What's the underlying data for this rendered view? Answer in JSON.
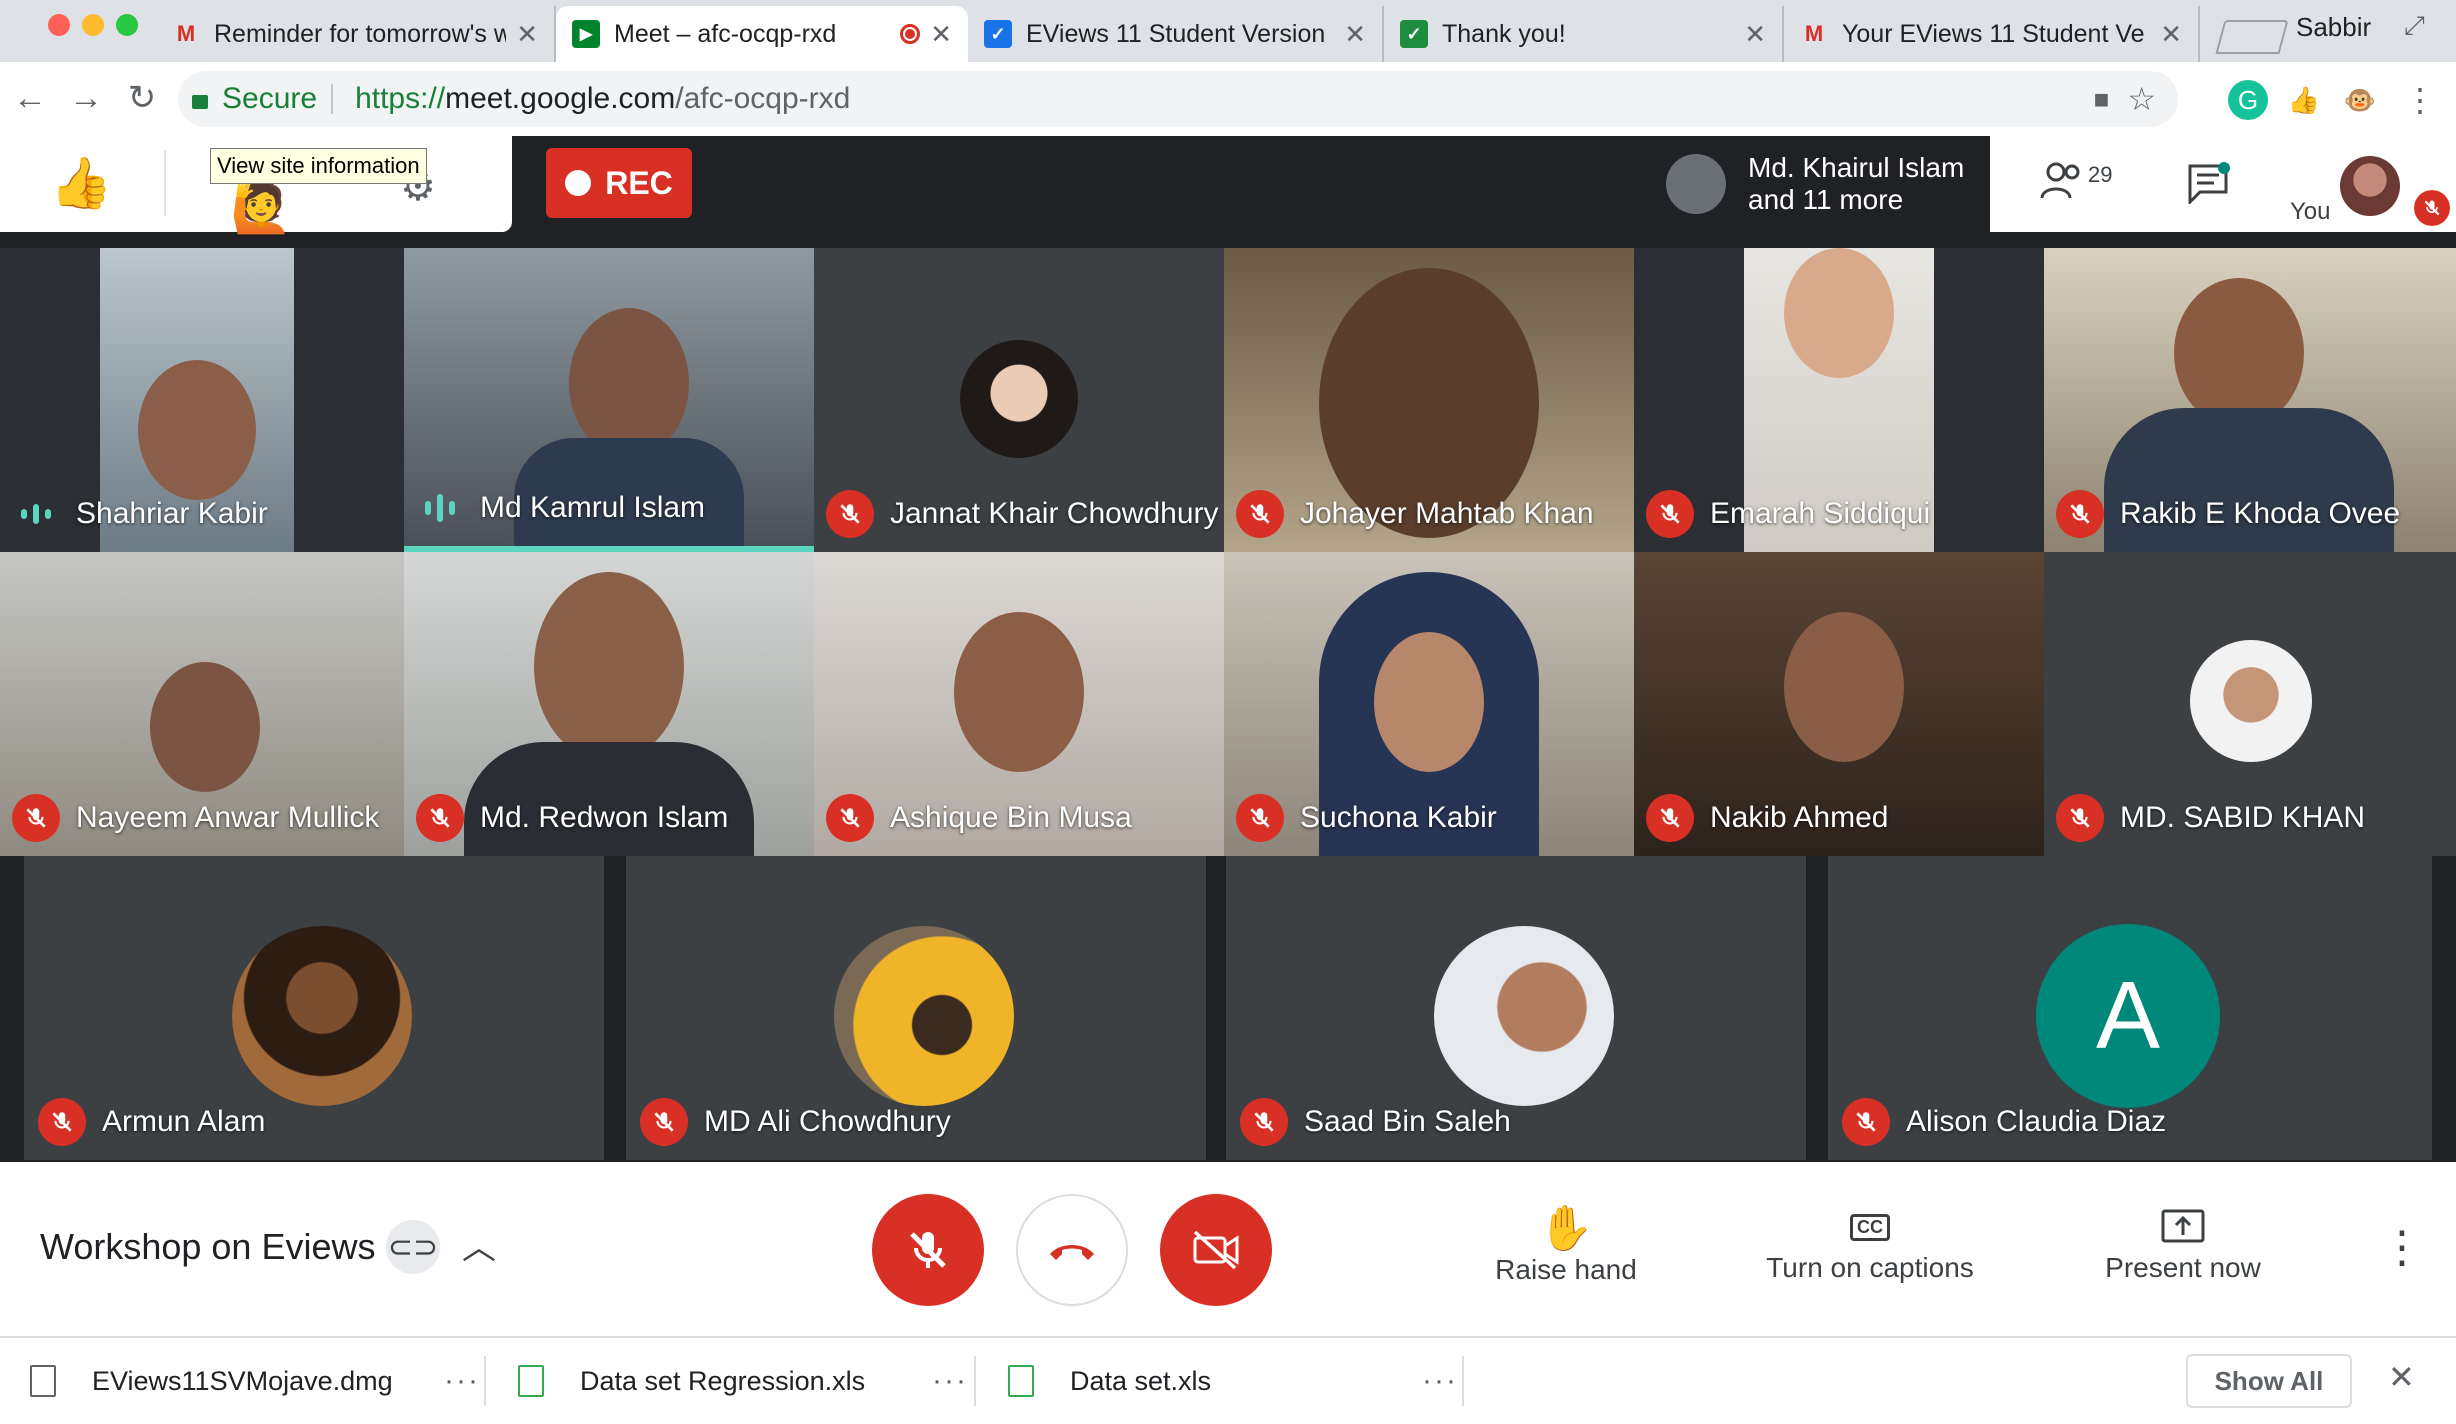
{
  "browser": {
    "profile_name": "Sabbir",
    "tabs": [
      {
        "title": "Reminder for tomorrow's w",
        "icon": "gmail-icon"
      },
      {
        "title": "Meet – afc-ocqp-rxd",
        "icon": "meet-icon",
        "active": true
      },
      {
        "title": "EViews 11 Student Version",
        "icon": "eviews-icon"
      },
      {
        "title": "Thank you!",
        "icon": "eviews-icon"
      },
      {
        "title": "Your EViews 11 Student Ve",
        "icon": "gmail-icon"
      }
    ],
    "secure_label": "Secure",
    "url_scheme": "https://",
    "url_host": "meet.google.com",
    "url_path": "/afc-ocqp-rxd",
    "tooltip": "View site information"
  },
  "meet": {
    "rec_label": "REC",
    "active_speaker_line1": "Md. Khairul Islam",
    "active_speaker_line2": "and 11 more",
    "participant_count": "29",
    "self_label": "You",
    "meeting_title": "Workshop on Eviews",
    "controls": {
      "raise_hand": "Raise hand",
      "captions": "Turn on captions",
      "present": "Present now"
    },
    "participants": [
      {
        "name": "Shahriar Kabir",
        "status": "speaking"
      },
      {
        "name": "Md Kamrul Islam",
        "status": "speaking"
      },
      {
        "name": "Jannat Khair Chowdhury",
        "status": "muted"
      },
      {
        "name": "Johayer Mahtab Khan",
        "status": "muted"
      },
      {
        "name": "Emarah Siddiqui",
        "status": "muted"
      },
      {
        "name": "Rakib E Khoda Ovee",
        "status": "muted"
      },
      {
        "name": "Nayeem Anwar Mullick",
        "status": "muted"
      },
      {
        "name": "Md. Redwon Islam",
        "status": "muted"
      },
      {
        "name": "Ashique Bin Musa",
        "status": "muted"
      },
      {
        "name": "Suchona Kabir",
        "status": "muted"
      },
      {
        "name": "Nakib Ahmed",
        "status": "muted"
      },
      {
        "name": "MD. SABID KHAN",
        "status": "muted"
      },
      {
        "name": "Armun Alam",
        "status": "muted"
      },
      {
        "name": "MD Ali Chowdhury",
        "status": "muted"
      },
      {
        "name": "Saad Bin Saleh",
        "status": "muted"
      },
      {
        "name": "Alison Claudia Diaz",
        "status": "muted",
        "initial": "A"
      }
    ]
  },
  "downloads": {
    "items": [
      {
        "name": "EViews11SVMojave.dmg"
      },
      {
        "name": "Data set Regression.xls"
      },
      {
        "name": "Data set.xls"
      }
    ],
    "show_all": "Show All"
  },
  "colors": {
    "meet_red": "#d93025",
    "speaking_teal": "#5bd4c0",
    "avatar_teal": "#00897b"
  }
}
